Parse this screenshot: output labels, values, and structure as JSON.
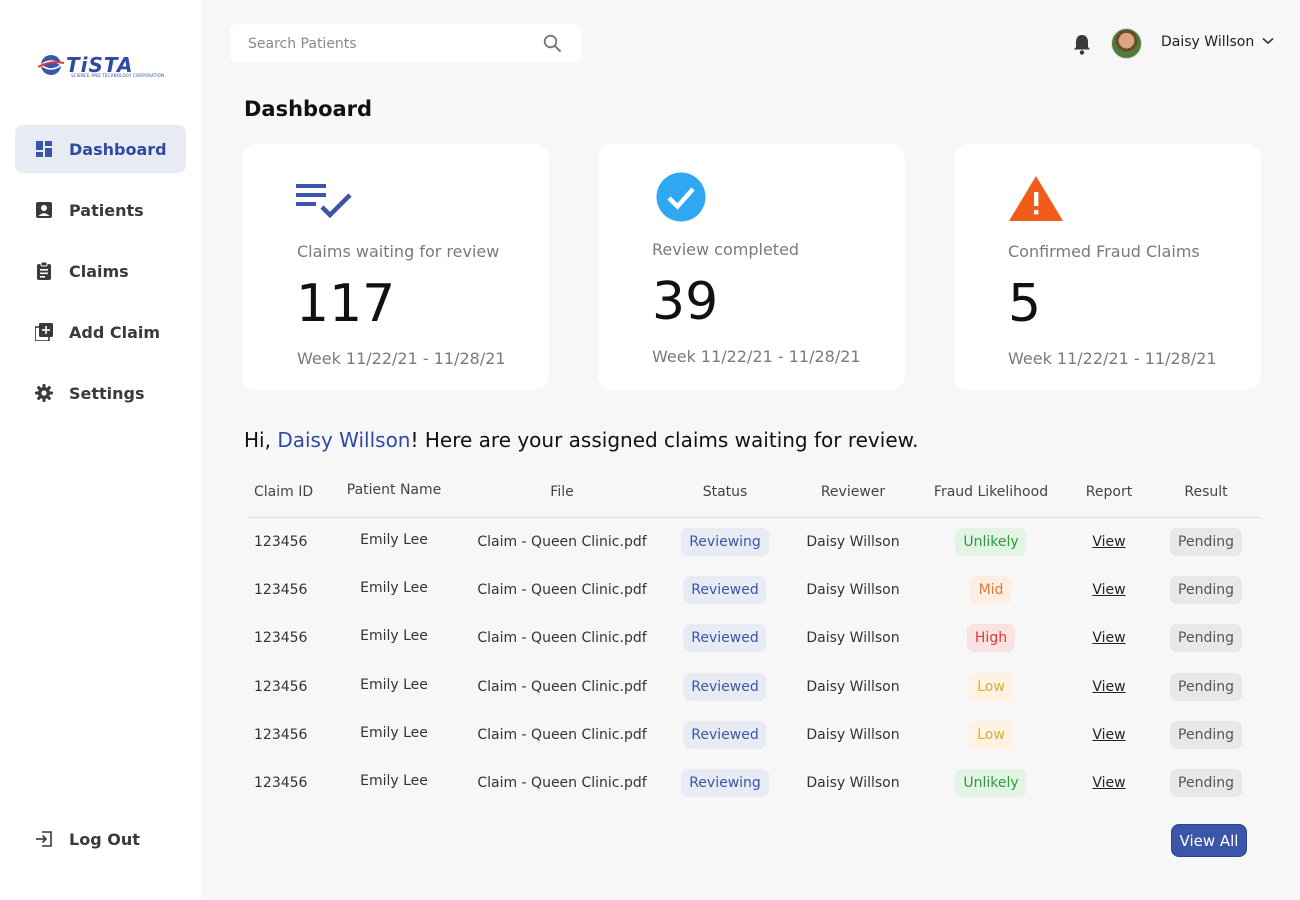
{
  "brand": {
    "name": "TiSTA",
    "tagline": "SCIENCE AND TECHNOLOGY CORPORATION"
  },
  "sidebar": {
    "items": [
      {
        "label": "Dashboard",
        "icon": "dashboard-icon",
        "active": true
      },
      {
        "label": "Patients",
        "icon": "patient-card-icon"
      },
      {
        "label": "Claims",
        "icon": "clipboard-icon"
      },
      {
        "label": "Add Claim",
        "icon": "add-box-icon"
      },
      {
        "label": "Settings",
        "icon": "gear-icon"
      }
    ],
    "logout": {
      "label": "Log Out",
      "icon": "logout-icon"
    }
  },
  "header": {
    "search_placeholder": "Search Patients",
    "user_name": "Daisy Willson"
  },
  "page": {
    "title": "Dashboard"
  },
  "cards": [
    {
      "label": "Claims waiting for review",
      "value": "117",
      "week": "Week 11/22/21 - 11/28/21",
      "icon": "list-check-icon",
      "icon_color": "#3b56a8"
    },
    {
      "label": "Review completed",
      "value": "39",
      "week": "Week 11/22/21 - 11/28/21",
      "icon": "check-circle-icon",
      "icon_color": "#2ea8f0"
    },
    {
      "label": "Confirmed Fraud Claims",
      "value": "5",
      "week": "Week 11/22/21 - 11/28/21",
      "icon": "warning-icon",
      "icon_color": "#f25c1b"
    }
  ],
  "greeting": {
    "prefix": "Hi, ",
    "name": "Daisy Willson",
    "suffix": "! Here are your assigned claims waiting for review."
  },
  "table": {
    "headers": [
      "Claim ID",
      "Patient Name",
      "File",
      "Status",
      "Reviewer",
      "Fraud Likelihood",
      "Report",
      "Result"
    ],
    "rows": [
      {
        "claim_id": "123456",
        "patient": "Emily Lee",
        "file": "Claim - Queen Clinic.pdf",
        "status": "Reviewing",
        "reviewer": "Daisy Willson",
        "fraud": "Unlikely",
        "fraud_level": "unlikely",
        "report": "View",
        "result": "Pending"
      },
      {
        "claim_id": "123456",
        "patient": "Emily Lee",
        "file": "Claim - Queen Clinic.pdf",
        "status": "Reviewed",
        "reviewer": "Daisy Willson",
        "fraud": "Mid",
        "fraud_level": "mid",
        "report": "View",
        "result": "Pending"
      },
      {
        "claim_id": "123456",
        "patient": "Emily Lee",
        "file": "Claim - Queen Clinic.pdf",
        "status": "Reviewed",
        "reviewer": "Daisy Willson",
        "fraud": "High",
        "fraud_level": "high",
        "report": "View",
        "result": "Pending"
      },
      {
        "claim_id": "123456",
        "patient": "Emily Lee",
        "file": "Claim - Queen Clinic.pdf",
        "status": "Reviewed",
        "reviewer": "Daisy Willson",
        "fraud": "Low",
        "fraud_level": "low",
        "report": "View",
        "result": "Pending"
      },
      {
        "claim_id": "123456",
        "patient": "Emily Lee",
        "file": "Claim - Queen Clinic.pdf",
        "status": "Reviewed",
        "reviewer": "Daisy Willson",
        "fraud": "Low",
        "fraud_level": "low",
        "report": "View",
        "result": "Pending"
      },
      {
        "claim_id": "123456",
        "patient": "Emily Lee",
        "file": "Claim - Queen Clinic.pdf",
        "status": "Reviewing",
        "reviewer": "Daisy Willson",
        "fraud": "Unlikely",
        "fraud_level": "unlikely",
        "report": "View",
        "result": "Pending"
      }
    ],
    "view_all_label": "View All"
  },
  "colors": {
    "accent": "#3b56a8",
    "background": "#f7f7f8"
  }
}
